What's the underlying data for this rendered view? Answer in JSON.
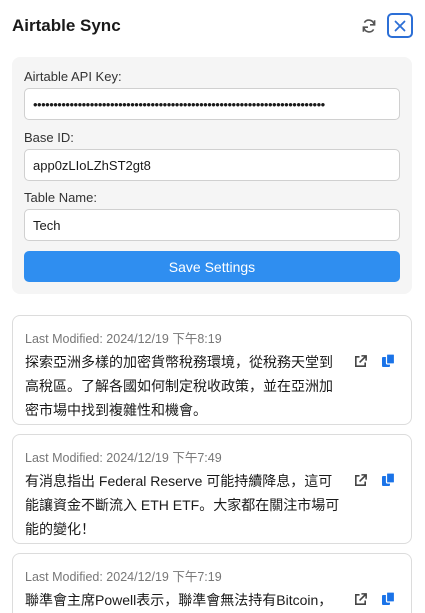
{
  "header": {
    "title": "Airtable Sync",
    "refresh_icon": "refresh-icon",
    "close_icon": "close-icon"
  },
  "settings": {
    "api_key_label": "Airtable API Key:",
    "api_key_value": "••••••••••••••••••••••••••••••••••••••••••••••••••••••••••••••••••••••••",
    "base_id_label": "Base ID:",
    "base_id_value": "app0zLIoLZhST2gt8",
    "table_name_label": "Table Name:",
    "table_name_value": "Tech",
    "save_label": "Save Settings"
  },
  "colors": {
    "accent": "#2f8ef0",
    "close_border": "#2c6fd6",
    "icon_blue": "#1a73e8"
  },
  "entries": [
    {
      "modified": "Last Modified: 2024/12/19 下午8:19",
      "text": "探索亞洲多樣的加密貨幣稅務環境，從稅務天堂到高稅區。了解各國如何制定稅收政策，並在亞洲加密市場中找到複雜性和機會。"
    },
    {
      "modified": "Last Modified: 2024/12/19 下午7:49",
      "text": "有消息指出 Federal Reserve 可能持續降息，這可能讓資金不斷流入 ETH ETF。大家都在關注市場可能的變化！"
    },
    {
      "modified": "Last Modified: 2024/12/19 下午7:19",
      "text": "聯準會主席Powell表示，聯準會無法持有Bitcoin，"
    }
  ]
}
